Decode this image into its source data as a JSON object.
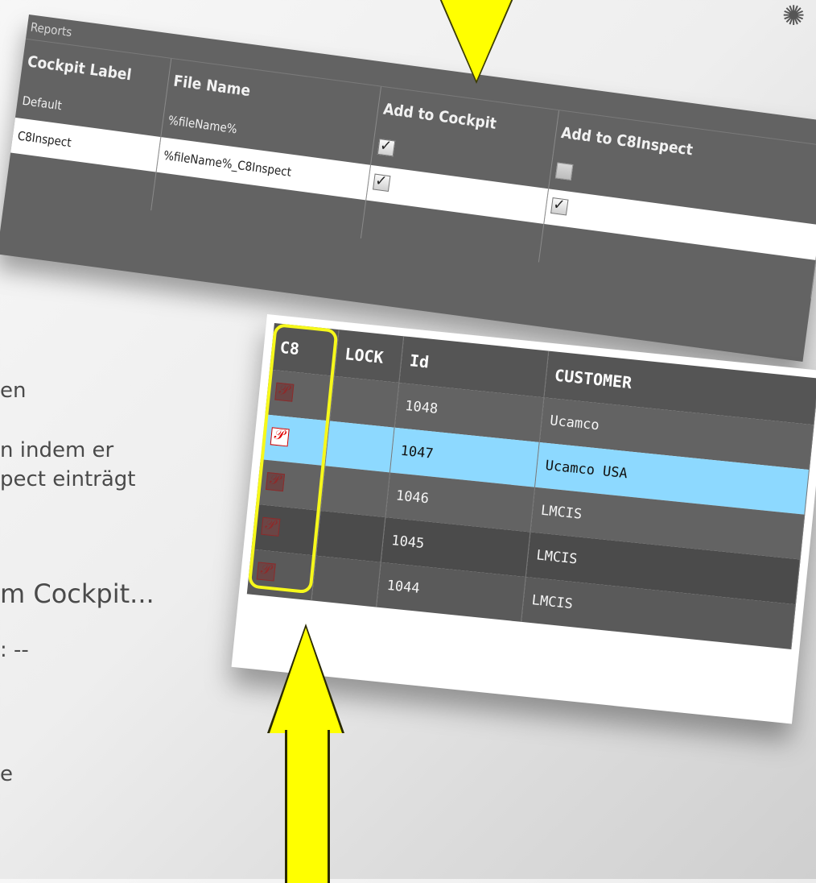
{
  "slide_text": [
    {
      "text": "en"
    },
    {
      "text": "n indem er"
    },
    {
      "text": "pect einträgt"
    },
    {
      "text": "m Cockpit..."
    },
    {
      "text": ": --"
    },
    {
      "text": "e"
    }
  ],
  "reports": {
    "title": "Reports",
    "headers": [
      "Cockpit Label",
      "File Name",
      "Add to Cockpit",
      "Add to C8Inspect"
    ],
    "rows": [
      {
        "label": "Default",
        "file": "%fileName%",
        "add_cockpit": true,
        "add_c8": false
      },
      {
        "label": "C8Inspect",
        "file": "%fileName%_C8Inspect",
        "add_cockpit": true,
        "add_c8": true
      }
    ]
  },
  "grid": {
    "headers": [
      "C8",
      "LOCK",
      "Id",
      "CUSTOMER"
    ],
    "rows": [
      {
        "id": "1048",
        "customer": "Ucamco",
        "c8_active": false
      },
      {
        "id": "1047",
        "customer": "Ucamco USA",
        "c8_active": true
      },
      {
        "id": "1046",
        "customer": "LMCIS",
        "c8_active": false
      },
      {
        "id": "1045",
        "customer": "LMCIS",
        "c8_active": false
      },
      {
        "id": "1044",
        "customer": "LMCIS",
        "c8_active": false
      }
    ]
  },
  "colors": {
    "highlight_row": "#8dd9ff",
    "arrow": "#ffff00",
    "frame": "#f6f81b"
  },
  "icons": [
    "c8-logo-icon",
    "checkbox-checked-icon",
    "checkbox-unchecked-icon",
    "sparkle-icon"
  ]
}
